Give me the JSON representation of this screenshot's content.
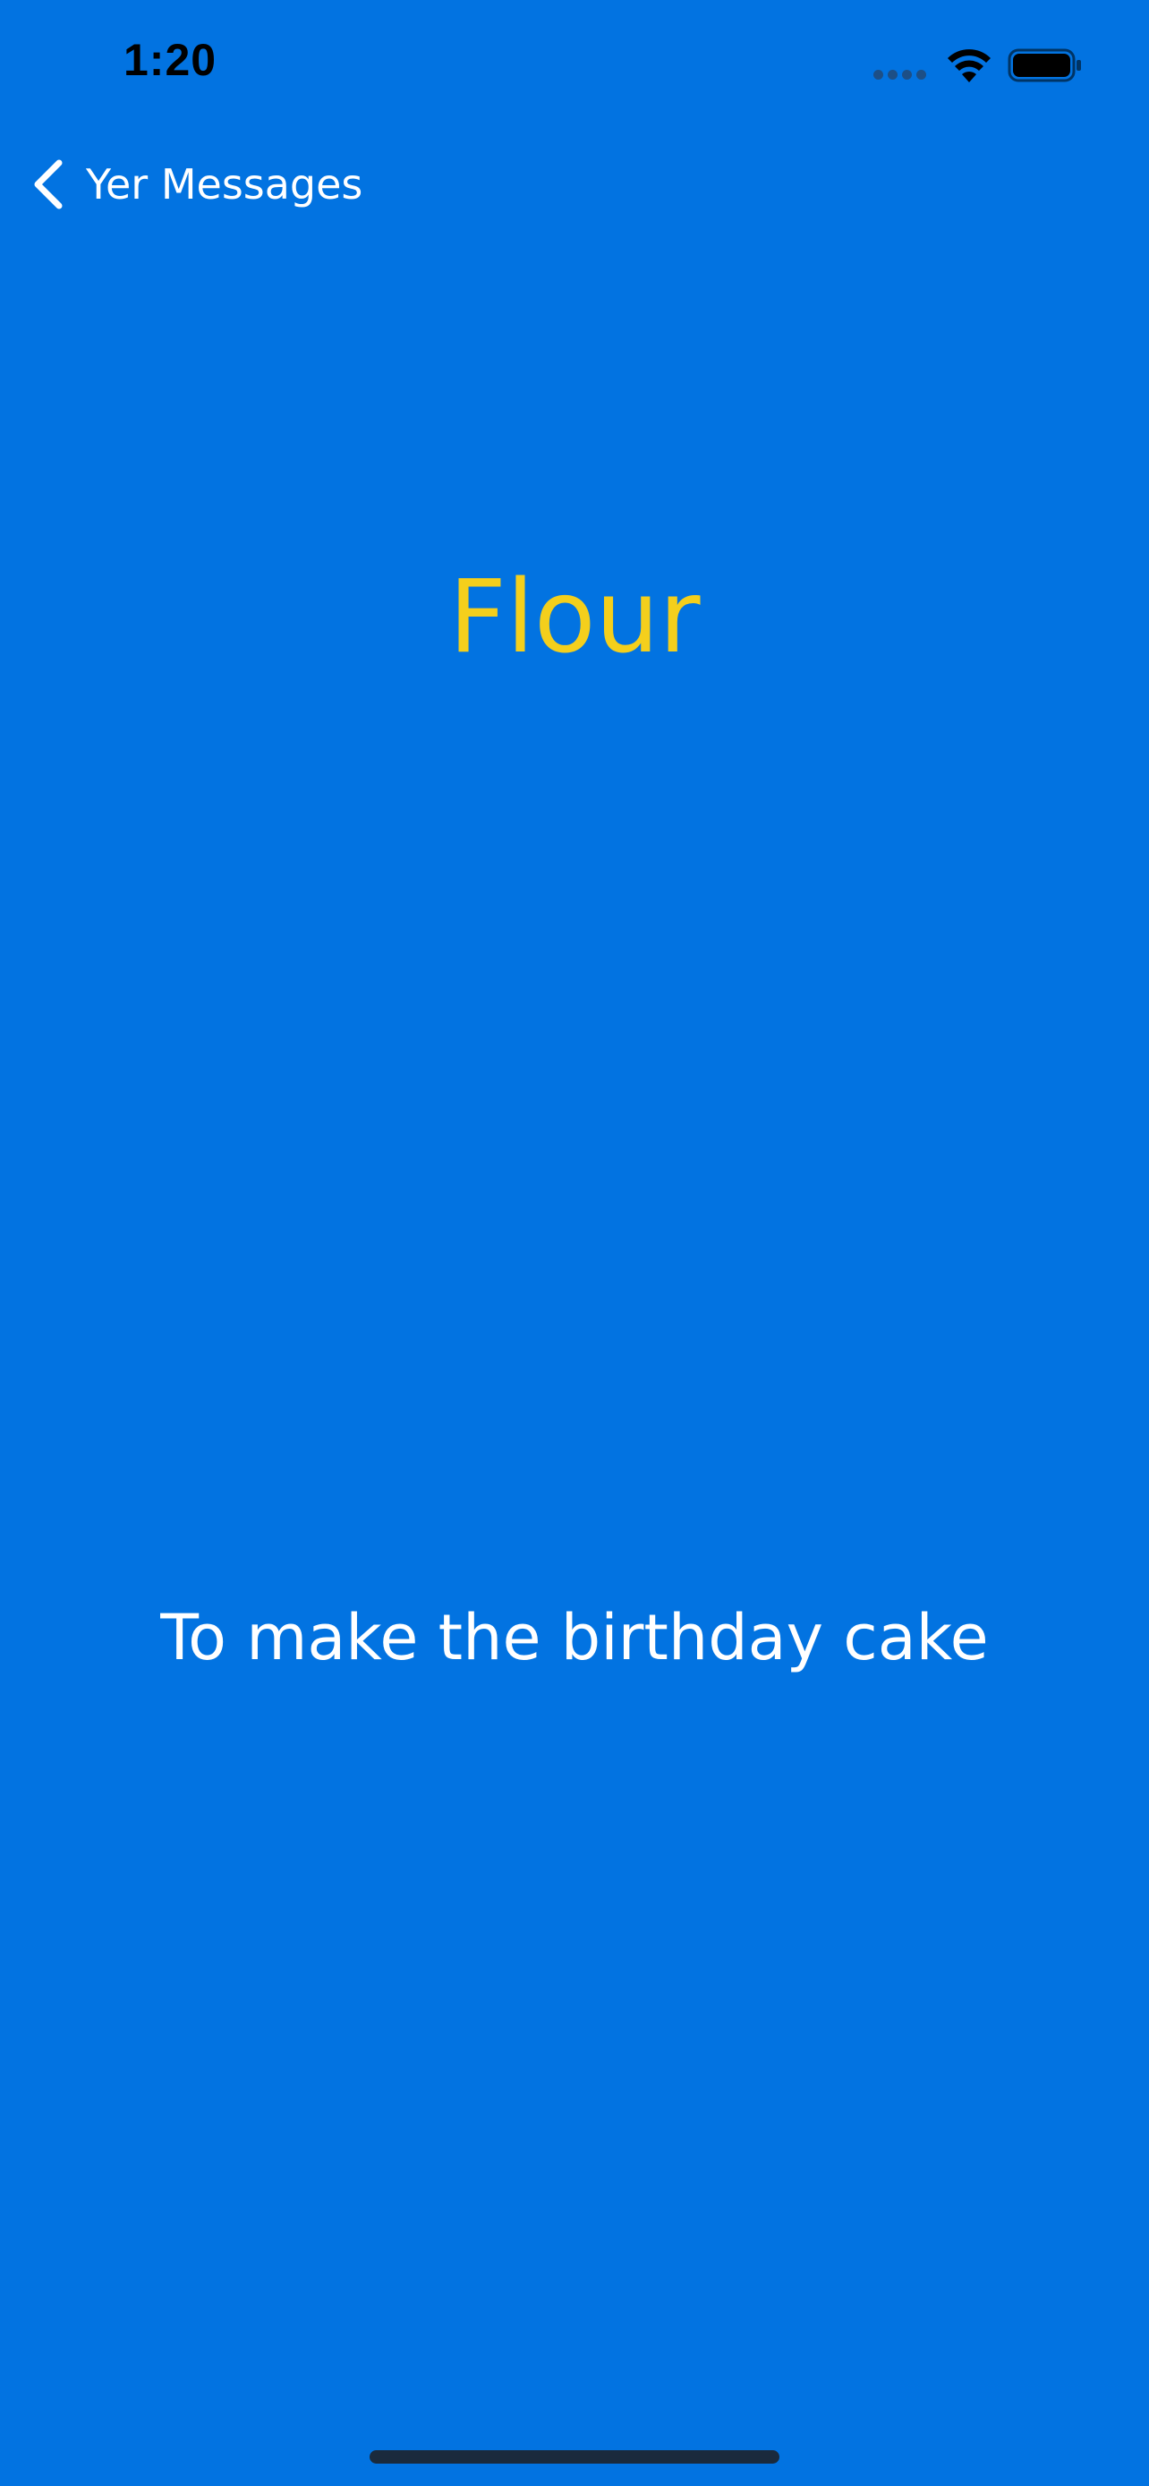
{
  "status_bar": {
    "time": "1:20",
    "icons": [
      "signal-icon",
      "wifi-icon",
      "battery-icon"
    ]
  },
  "navigation": {
    "back_label": "Yer Messages",
    "back_icon": "chevron-left-icon"
  },
  "content": {
    "title": "Flour",
    "message": "To make the birthday cake"
  },
  "colors": {
    "background": "#0273e1",
    "title": "#f4cf1c",
    "message": "#ffffff",
    "status_text": "#000000"
  }
}
